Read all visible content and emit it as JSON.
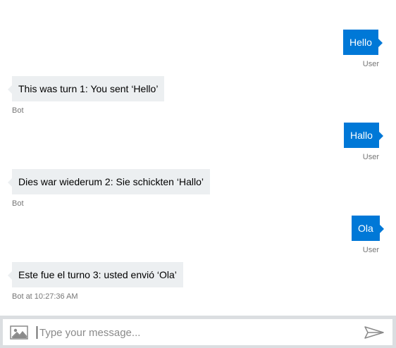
{
  "messages": [
    {
      "from": "user",
      "text": "Hello",
      "meta": "User"
    },
    {
      "from": "bot",
      "text": "This was turn 1: You sent ‘Hello’",
      "meta": "Bot"
    },
    {
      "from": "user",
      "text": "Hallo",
      "meta": "User"
    },
    {
      "from": "bot",
      "text": "Dies war wiederum 2: Sie schickten ‘Hallo’",
      "meta": "Bot"
    },
    {
      "from": "user",
      "text": "Ola",
      "meta": "User"
    },
    {
      "from": "bot",
      "text": "Este fue el turno 3: usted envió ‘Ola’",
      "meta": "Bot at 10:27:36 AM"
    }
  ],
  "input": {
    "placeholder": "Type your message...",
    "value": "",
    "upload_icon": "image-upload-icon",
    "send_icon": "send-icon"
  },
  "colors": {
    "user_bubble": "#0078d7",
    "bot_bubble": "#eceff1",
    "meta_text": "#767676",
    "input_bar": "#dbdee1"
  }
}
